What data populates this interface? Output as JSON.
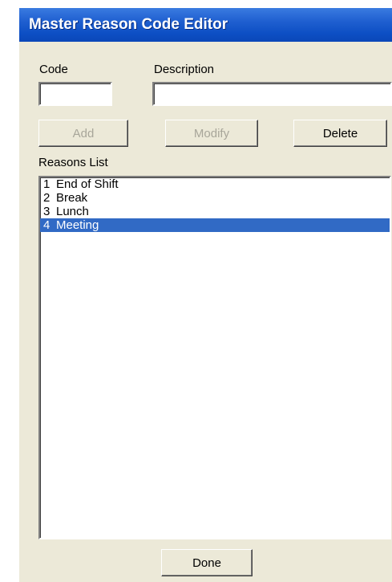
{
  "window": {
    "title": "Master Reason Code Editor"
  },
  "form": {
    "code_label": "Code",
    "code_value": "",
    "description_label": "Description",
    "description_value": ""
  },
  "buttons": {
    "add": "Add",
    "add_enabled": false,
    "modify": "Modify",
    "modify_enabled": false,
    "delete": "Delete",
    "delete_enabled": true,
    "done": "Done"
  },
  "reasons": {
    "label": "Reasons List",
    "items": [
      {
        "code": "1",
        "description": "End of Shift",
        "selected": false
      },
      {
        "code": "2",
        "description": "Break",
        "selected": false
      },
      {
        "code": "3",
        "description": "Lunch",
        "selected": false
      },
      {
        "code": "4",
        "description": "Meeting",
        "selected": true
      }
    ]
  },
  "colors": {
    "titlebar": "#0d4fc4",
    "window_bg": "#ece9d8",
    "selection": "#316ac5",
    "disabled_text": "#a8a69a"
  }
}
